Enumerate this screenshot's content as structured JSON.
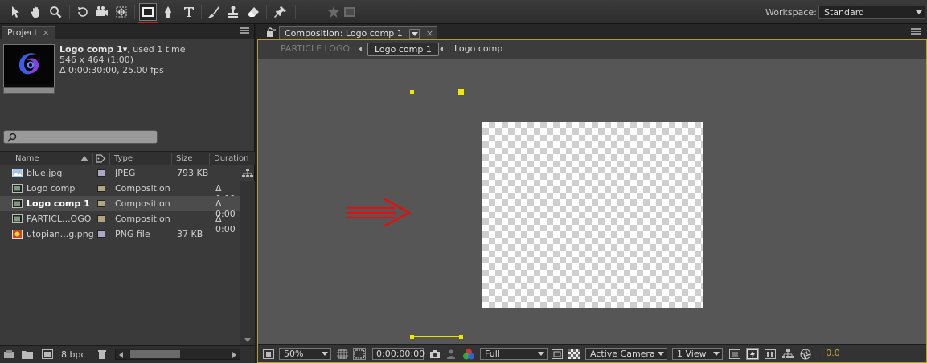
{
  "toolbar": {
    "tools": [
      {
        "name": "selection-tool-icon"
      },
      {
        "name": "hand-tool-icon"
      },
      {
        "name": "zoom-tool-icon"
      },
      {
        "name": "rotate-tool-icon"
      },
      {
        "name": "camera-tool-icon"
      },
      {
        "name": "pan-behind-tool-icon"
      },
      {
        "name": "rectangle-tool-icon",
        "active": true
      },
      {
        "name": "pen-tool-icon"
      },
      {
        "name": "type-tool-icon"
      },
      {
        "name": "brush-tool-icon"
      },
      {
        "name": "clone-stamp-tool-icon"
      },
      {
        "name": "eraser-tool-icon"
      },
      {
        "name": "puppet-pin-tool-icon"
      }
    ],
    "workspace_label": "Workspace:",
    "workspace_value": "Standard"
  },
  "project": {
    "tab_label": "Project",
    "tab_close": "×",
    "selected": {
      "name": "Logo comp 1▾",
      "used": ", used 1 time",
      "size": "546 x 464 (1.00)",
      "duration": "Δ 0:00:30:00, 25.00 fps"
    },
    "columns": {
      "name": "Name",
      "type": "Type",
      "size": "Size",
      "duration": "Duration"
    },
    "rows": [
      {
        "name": "blue.jpg",
        "type": "JPEG",
        "size": "793 KB",
        "duration": "",
        "icon": "image-file-icon",
        "label_color": "#a9a6c6",
        "selected": false
      },
      {
        "name": "Logo comp",
        "type": "Composition",
        "size": "",
        "duration": "Δ 0:00",
        "icon": "composition-icon",
        "label_color": "#b1a47f",
        "selected": false
      },
      {
        "name": "Logo comp 1",
        "type": "Composition",
        "size": "",
        "duration": "Δ 0:00",
        "icon": "composition-icon",
        "label_color": "#b1a47f",
        "selected": true
      },
      {
        "name": "PARTICL...OGO",
        "type": "Composition",
        "size": "",
        "duration": "Δ 0:00",
        "icon": "composition-icon",
        "label_color": "#b1a47f",
        "selected": false
      },
      {
        "name": "utopian...g.png",
        "type": "PNG file",
        "size": "37 KB",
        "duration": "",
        "icon": "png-file-icon",
        "label_color": "#a9a6c6",
        "selected": false
      }
    ],
    "bpc": "8 bpc"
  },
  "composition": {
    "tab_label": "Composition: Logo comp 1",
    "tab_close": "×",
    "breadcrumbs": [
      "PARTICLE LOGO",
      "Logo comp 1",
      "Logo comp"
    ],
    "zoom": "50%",
    "timecode": "0:00:00:00",
    "resolution": "Full",
    "camera": "Active Camera",
    "views": "1 View",
    "exposure": "+0.0",
    "colors": {
      "layer_bounds": "#e8e000",
      "annotation_arrow": "#e01010",
      "panel_highlight": "#b59a32"
    }
  }
}
